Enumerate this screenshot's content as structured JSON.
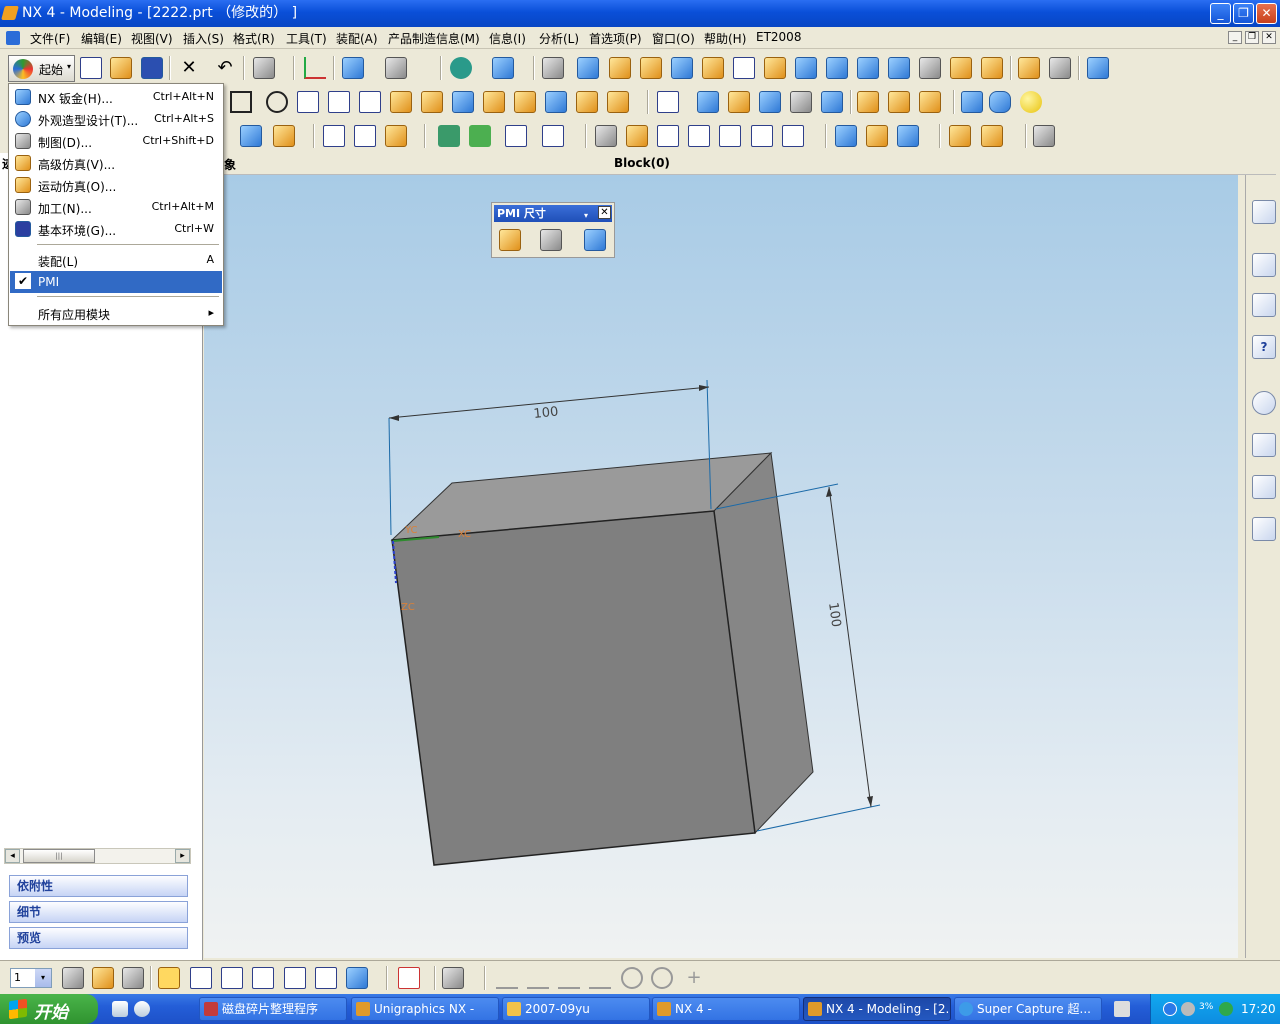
{
  "window": {
    "title": "NX 4 - Modeling - [2222.prt （修改的） ]",
    "controls": {
      "minimize": "_",
      "restore": "❐",
      "close": "✕"
    }
  },
  "menubar": {
    "items": [
      "文件(F)",
      "编辑(E)",
      "视图(V)",
      "插入(S)",
      "格式(R)",
      "工具(T)",
      "装配(A)",
      "产品制造信息(M)",
      "信息(I)",
      "分析(L)",
      "首选项(P)",
      "窗口(O)",
      "帮助(H)",
      "ET2008"
    ],
    "doc_controls": [
      "_",
      "❐",
      "✕"
    ]
  },
  "toolbar": {
    "start_label": "起始",
    "start_arrow": "▾"
  },
  "start_menu": {
    "items": [
      {
        "label": "NX 钣金(H)...",
        "shortcut": "Ctrl+Alt+N",
        "icon": "sheet-metal-icon"
      },
      {
        "label": "外观造型设计(T)...",
        "shortcut": "Ctrl+Alt+S",
        "icon": "shape-studio-icon"
      },
      {
        "label": "制图(D)...",
        "shortcut": "Ctrl+Shift+D",
        "icon": "drafting-icon"
      },
      {
        "label": "高级仿真(V)...",
        "shortcut": "",
        "icon": "advanced-simulation-icon"
      },
      {
        "label": "运动仿真(O)...",
        "shortcut": "",
        "icon": "motion-simulation-icon"
      },
      {
        "label": "加工(N)...",
        "shortcut": "Ctrl+Alt+M",
        "icon": "manufacturing-icon"
      },
      {
        "label": "基本环境(G)...",
        "shortcut": "Ctrl+W",
        "icon": "gateway-icon"
      }
    ],
    "assembly": {
      "label": "装配(L)",
      "shortcut": "A"
    },
    "pmi": {
      "label": "PMI",
      "checked": "✔"
    },
    "all_apps": {
      "label": "所有应用模块",
      "arrow": "▸"
    }
  },
  "header": {
    "left_fragment": "象",
    "nav_fragment": "迹",
    "part_label": "Block(0)"
  },
  "nav_panel": {
    "scroll_left": "◂",
    "scroll_right": "▸",
    "thumb_grip": "|||",
    "panels": [
      "依附性",
      "细节",
      "预览"
    ]
  },
  "pmi_toolbar": {
    "title": "PMI 尺寸",
    "menu_arrow": "▾",
    "close": "✕"
  },
  "model": {
    "dim_top": "100",
    "dim_right": "100",
    "axis_labels": {
      "yc": "YC",
      "xc": "XC",
      "zc": "ZC"
    },
    "colors": {
      "front_face": "#7f7f7f",
      "top_face": "#9a9a9a",
      "side_face": "#868686",
      "dimension_line": "#1b6aa8"
    }
  },
  "resource_bar": {
    "icons": [
      "assembly-navigator-icon",
      "part-navigator-icon",
      "training-icon",
      "help-icon",
      "history-icon",
      "system-materials-icon",
      "process-studio-icon",
      "roles-icon"
    ],
    "help_glyph": "?"
  },
  "bottom_toolbar": {
    "layer_value": "1",
    "layer_arrow": "▾"
  },
  "taskbar": {
    "start_label": "开始",
    "buttons": [
      {
        "label": "磁盘碎片整理程序",
        "color": "#c23b3b"
      },
      {
        "label": "Unigraphics NX -",
        "color": "#e09a2a"
      },
      {
        "label": "2007-09yu",
        "color": "#f2c24a"
      },
      {
        "label": "NX 4 -",
        "color": "#e09a2a"
      },
      {
        "label": "NX 4 - Modeling - [2...",
        "color": "#e09a2a"
      },
      {
        "label": "Super Capture 超...",
        "color": "#3d9be8"
      }
    ],
    "tray_pct": "3%",
    "clock": "17:20"
  }
}
